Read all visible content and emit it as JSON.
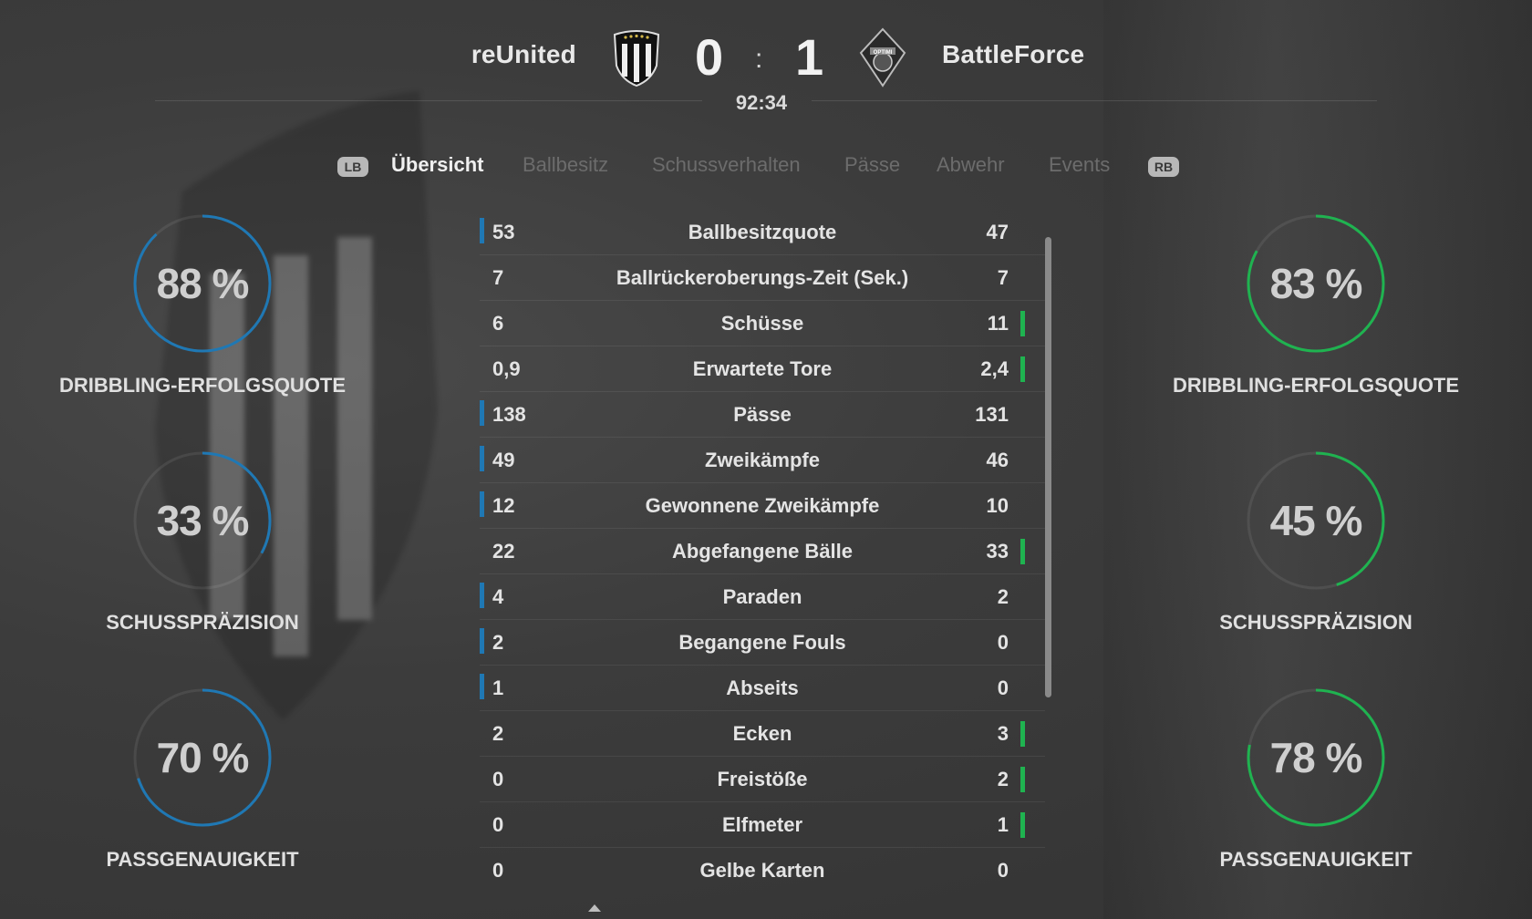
{
  "header": {
    "home_team": "reUnited",
    "away_team": "BattleForce",
    "home_score": "0",
    "separator": ":",
    "away_score": "1",
    "clock": "92:34",
    "away_crest_text": "OPTIMI"
  },
  "tabs": {
    "left_bumper": "LB",
    "right_bumper": "RB",
    "items": [
      {
        "label": "Übersicht",
        "active": true
      },
      {
        "label": "Ballbesitz",
        "active": false
      },
      {
        "label": "Schussverhalten",
        "active": false
      },
      {
        "label": "Pässe",
        "active": false
      },
      {
        "label": "Abwehr",
        "active": false
      },
      {
        "label": "Events",
        "active": false
      }
    ]
  },
  "colors": {
    "home_accent": "#1f78b4",
    "away_accent": "#1fb350"
  },
  "home_gauges": [
    {
      "value": "88 %",
      "percent": 88,
      "label": "DRIBBLING-ERFOLGSQUOTE"
    },
    {
      "value": "33 %",
      "percent": 33,
      "label": "SCHUSSPRÄZISION"
    },
    {
      "value": "70 %",
      "percent": 70,
      "label": "PASSGENAUIGKEIT"
    }
  ],
  "away_gauges": [
    {
      "value": "83 %",
      "percent": 83,
      "label": "DRIBBLING-ERFOLGSQUOTE"
    },
    {
      "value": "45 %",
      "percent": 45,
      "label": "SCHUSSPRÄZISION"
    },
    {
      "value": "78 %",
      "percent": 78,
      "label": "PASSGENAUIGKEIT"
    }
  ],
  "stats": [
    {
      "label": "Ballbesitzquote",
      "home": "53",
      "away": "47",
      "lead": "home"
    },
    {
      "label": "Ballrückeroberungs-Zeit (Sek.)",
      "home": "7",
      "away": "7",
      "lead": "none"
    },
    {
      "label": "Schüsse",
      "home": "6",
      "away": "11",
      "lead": "away"
    },
    {
      "label": "Erwartete Tore",
      "home": "0,9",
      "away": "2,4",
      "lead": "away"
    },
    {
      "label": "Pässe",
      "home": "138",
      "away": "131",
      "lead": "home"
    },
    {
      "label": "Zweikämpfe",
      "home": "49",
      "away": "46",
      "lead": "home"
    },
    {
      "label": "Gewonnene Zweikämpfe",
      "home": "12",
      "away": "10",
      "lead": "home"
    },
    {
      "label": "Abgefangene Bälle",
      "home": "22",
      "away": "33",
      "lead": "away"
    },
    {
      "label": "Paraden",
      "home": "4",
      "away": "2",
      "lead": "home"
    },
    {
      "label": "Begangene Fouls",
      "home": "2",
      "away": "0",
      "lead": "home"
    },
    {
      "label": "Abseits",
      "home": "1",
      "away": "0",
      "lead": "home"
    },
    {
      "label": "Ecken",
      "home": "2",
      "away": "3",
      "lead": "away"
    },
    {
      "label": "Freistöße",
      "home": "0",
      "away": "2",
      "lead": "away"
    },
    {
      "label": "Elfmeter",
      "home": "0",
      "away": "1",
      "lead": "away"
    },
    {
      "label": "Gelbe Karten",
      "home": "0",
      "away": "0",
      "lead": "none"
    }
  ]
}
